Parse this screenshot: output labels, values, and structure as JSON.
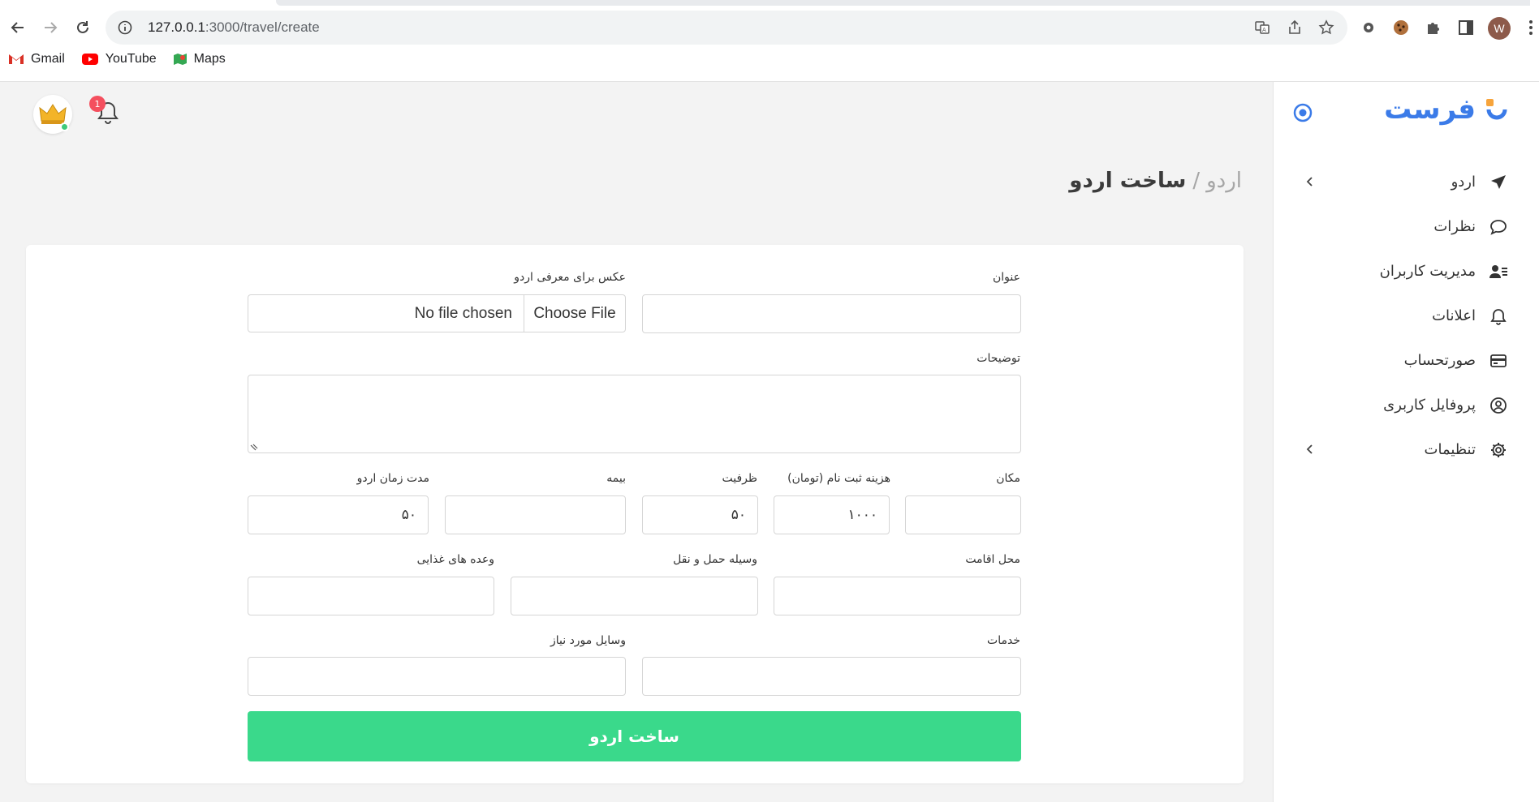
{
  "browser": {
    "url_host": "127.0.0.1",
    "url_path": ":3000/travel/create",
    "profile_initial": "W",
    "bookmarks": [
      {
        "label": "Gmail"
      },
      {
        "label": "YouTube"
      },
      {
        "label": "Maps"
      }
    ]
  },
  "sidebar": {
    "brand": "فرست",
    "items": [
      {
        "label": "اردو",
        "icon": "plane-icon",
        "has_submenu": true
      },
      {
        "label": "نظرات",
        "icon": "comment-icon",
        "has_submenu": false
      },
      {
        "label": "مدیریت کاربران",
        "icon": "users-icon",
        "has_submenu": false
      },
      {
        "label": "اعلانات",
        "icon": "bell-icon",
        "has_submenu": false
      },
      {
        "label": "صورتحساب",
        "icon": "credit-card-icon",
        "has_submenu": false
      },
      {
        "label": "پروفایل کاربری",
        "icon": "user-circle-icon",
        "has_submenu": false
      },
      {
        "label": "تنظیمات",
        "icon": "gear-icon",
        "has_submenu": true
      }
    ]
  },
  "header": {
    "notification_count": "1"
  },
  "breadcrumb": {
    "parent": "اردو",
    "separator": "/",
    "current": "ساخت اردو"
  },
  "form": {
    "title": {
      "label": "عنوان",
      "value": ""
    },
    "image": {
      "label": "عکس برای معرفی اردو",
      "button": "Choose File",
      "status": "No file chosen"
    },
    "description": {
      "label": "توضیحات",
      "value": ""
    },
    "location": {
      "label": "مکان",
      "value": ""
    },
    "fee": {
      "label": "هزینه ثبت نام (تومان)",
      "value": "۱۰۰۰"
    },
    "capacity": {
      "label": "ظرفیت",
      "value": "۵۰"
    },
    "insurance": {
      "label": "بیمه",
      "value": ""
    },
    "duration": {
      "label": "مدت زمان اردو",
      "value": "۵۰"
    },
    "accommodation": {
      "label": "محل اقامت",
      "value": ""
    },
    "transport": {
      "label": "وسیله حمل و نقل",
      "value": ""
    },
    "meals": {
      "label": "وعده های غذایی",
      "value": ""
    },
    "services": {
      "label": "خدمات",
      "value": ""
    },
    "equipment": {
      "label": "وسایل مورد نیاز",
      "value": ""
    },
    "submit_label": "ساخت اردو"
  },
  "colors": {
    "accent": "#3b7be8",
    "submit": "#3ad98b",
    "badge": "#f44f5e",
    "online": "#3ec97a"
  }
}
